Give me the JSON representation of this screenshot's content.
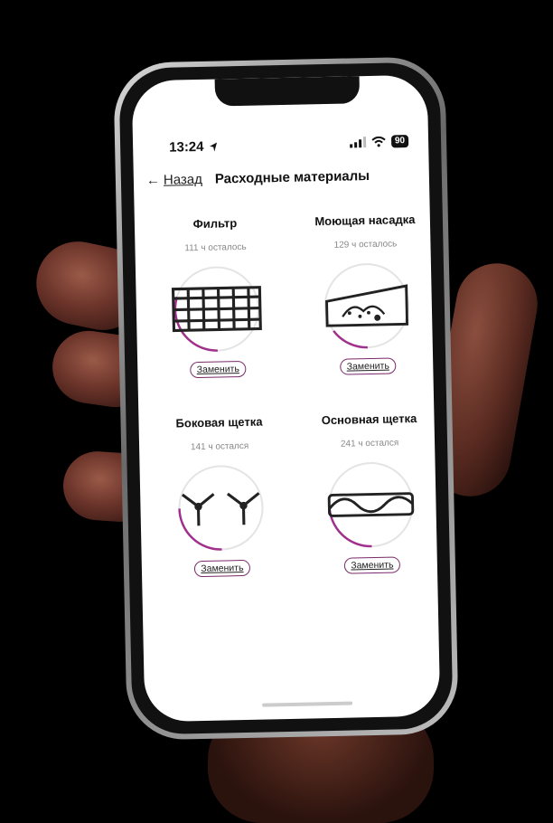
{
  "status_bar": {
    "time": "13:24",
    "battery": "90"
  },
  "nav": {
    "back_label": "Назад",
    "title": "Расходные материалы"
  },
  "consumables": [
    {
      "name": "Фильтр",
      "remaining": "111 ч осталось",
      "button": "Заменить",
      "icon": "filter-icon",
      "level": 0.3
    },
    {
      "name": "Моющая насадка",
      "remaining": "129 ч осталось",
      "button": "Заменить",
      "icon": "mop-pad-icon",
      "level": 0.15
    },
    {
      "name": "Боковая щетка",
      "remaining": "141 ч остался",
      "button": "Заменить",
      "icon": "side-brush-icon",
      "level": 0.25
    },
    {
      "name": "Основная щетка",
      "remaining": "241 ч остался",
      "button": "Заменить",
      "icon": "main-brush-icon",
      "level": 0.25
    }
  ],
  "colors": {
    "accent": "#a0308c",
    "ring_track": "#e4e4e4"
  }
}
